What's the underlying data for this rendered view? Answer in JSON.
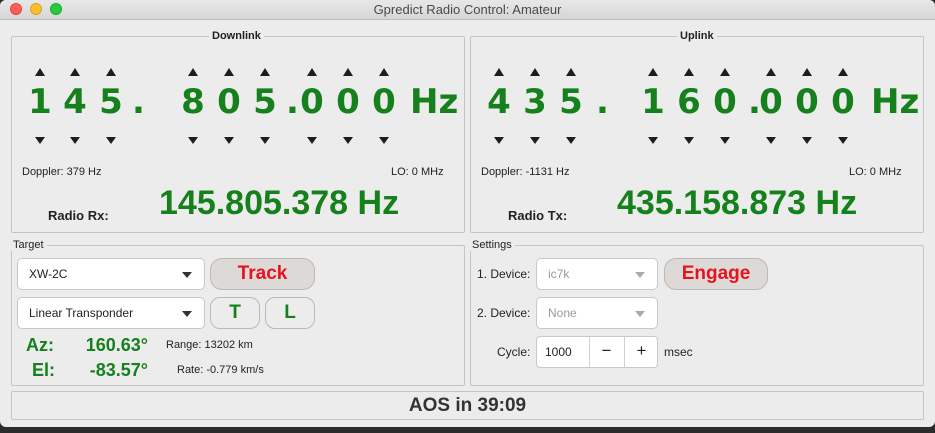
{
  "window": {
    "title": "Gpredict Radio Control: Amateur"
  },
  "downlink": {
    "label": "Downlink",
    "digits": [
      "1",
      "4",
      "5",
      ".",
      "8",
      "0",
      "5",
      ".",
      "0",
      "0",
      "0"
    ],
    "unit": "Hz",
    "doppler": "Doppler: 379 Hz",
    "lo": "LO:  0 MHz",
    "radio_label": "Radio Rx:",
    "radio_freq": "145.805.378 Hz"
  },
  "uplink": {
    "label": "Uplink",
    "digits": [
      "4",
      "3",
      "5",
      ".",
      "1",
      "6",
      "0",
      ".",
      "0",
      "0",
      "0"
    ],
    "unit": "Hz",
    "doppler": "Doppler: -1131 Hz",
    "lo": "LO:  0 MHz",
    "radio_label": "Radio Tx:",
    "radio_freq": "435.158.873 Hz"
  },
  "target": {
    "label": "Target",
    "satellite": "XW-2C",
    "transponder": "Linear Transponder",
    "track_label": "Track",
    "t_label": "T",
    "l_label": "L",
    "az_label": "Az:",
    "az_value": "160.63°",
    "el_label": "El:",
    "el_value": "-83.57°",
    "range": "Range: 13202 km",
    "rate": "Rate: -0.779 km/s"
  },
  "settings": {
    "label": "Settings",
    "device1_label": "1. Device:",
    "device1_value": "ic7k",
    "device2_label": "2. Device:",
    "device2_value": "None",
    "engage_label": "Engage",
    "cycle_label": "Cycle:",
    "cycle_value": "1000",
    "minus": "−",
    "plus": "+",
    "cycle_unit": "msec"
  },
  "status": {
    "aos": "AOS in 39:09"
  },
  "colors": {
    "freq_green": "#15801c",
    "button_red": "#e8121e"
  }
}
